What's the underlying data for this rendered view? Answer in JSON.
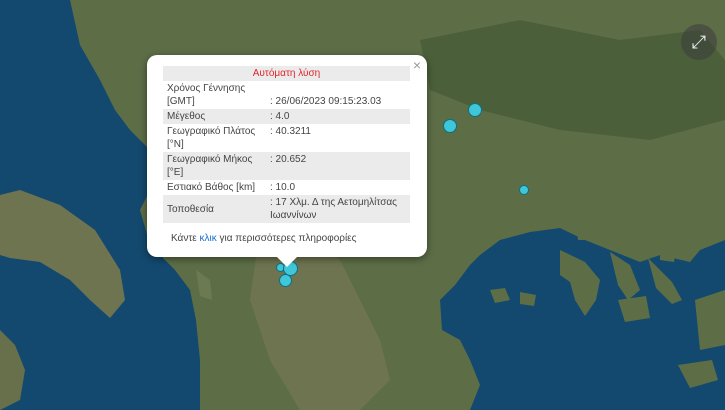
{
  "popup": {
    "title": "Αυτόματη λύση",
    "close_symbol": "×",
    "rows": [
      {
        "label": "Χρόνος Γέννησης [GMT]",
        "value": ": 26/06/2023 09:15:23.03"
      },
      {
        "label": "Μέγεθος",
        "value": ": 4.0"
      },
      {
        "label": "Γεωγραφικό Πλάτος [°N]",
        "value": ": 40.3211"
      },
      {
        "label": "Γεωγραφικό Μήκος [°E]",
        "value": ": 20.652"
      },
      {
        "label": "Εστιακό Βάθος [km]",
        "value": ": 10.0"
      },
      {
        "label": "Τοποθεσία",
        "value": ": 17 Χλμ. Δ της Αετομηλίτσας Ιωαννίνων"
      }
    ],
    "more_prefix": "Κάντε ",
    "more_link": "κλικ",
    "more_suffix": " για περισσότερες πληροφορίες"
  },
  "controls": {
    "fullscreen_icon": "⤢"
  },
  "colors": {
    "sea": "#13496f",
    "marker": "#3fc6d8",
    "title": "#e0262a",
    "link": "#1b6ed1"
  }
}
